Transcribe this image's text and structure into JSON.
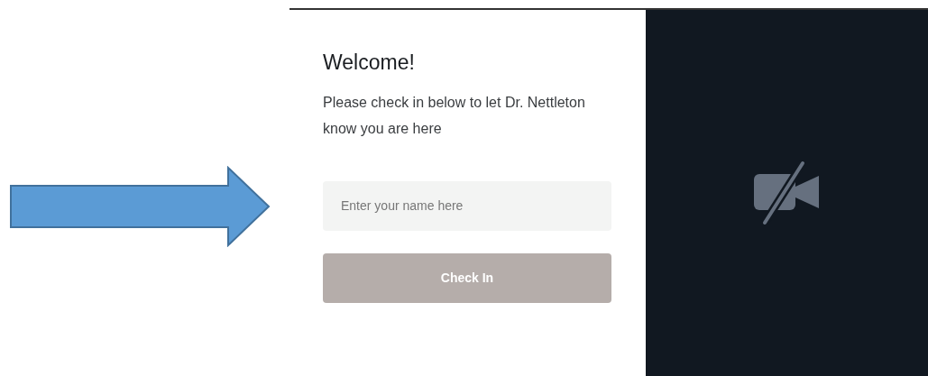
{
  "checkin_panel": {
    "title": "Welcome!",
    "message": "Please check in below to let Dr. Nettleton know you are here",
    "name_field": {
      "placeholder": "Enter your name here"
    },
    "check_in_button": {
      "label": "Check In",
      "disabled": true
    }
  },
  "video_preview": {
    "camera_off": true
  }
}
